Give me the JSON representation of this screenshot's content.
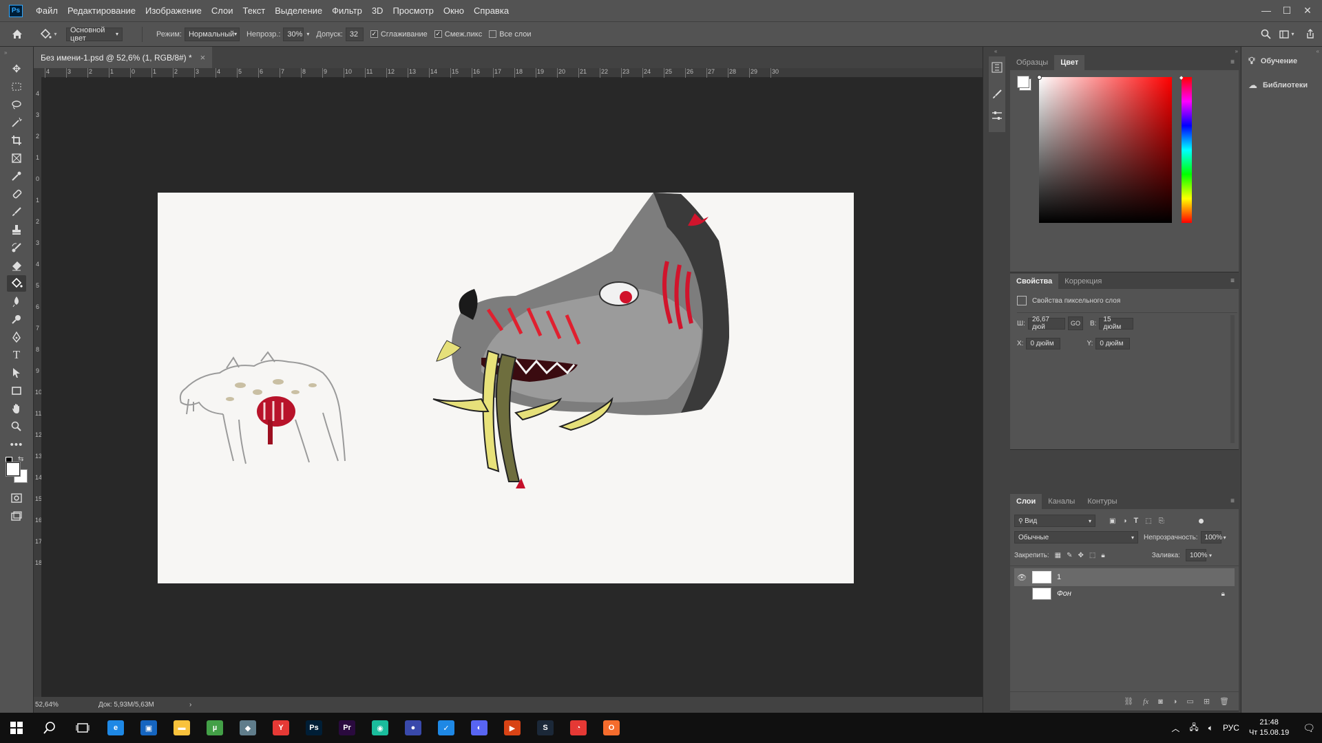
{
  "app": {
    "logo": "Ps"
  },
  "menu": [
    "Файл",
    "Редактирование",
    "Изображение",
    "Слои",
    "Текст",
    "Выделение",
    "Фильтр",
    "3D",
    "Просмотр",
    "Окно",
    "Справка"
  ],
  "window_controls": {
    "minimize": "—",
    "maximize": "☐",
    "close": "✕"
  },
  "options": {
    "fill_source": "Основной цвет",
    "mode_label": "Режим:",
    "mode_value": "Нормальный",
    "opacity_label": "Непрозр.:",
    "opacity_value": "30%",
    "tolerance_label": "Допуск:",
    "tolerance_value": "32",
    "antialias_label": "Сглаживание",
    "antialias_checked": true,
    "contiguous_label": "Смеж.пикс",
    "contiguous_checked": true,
    "all_layers_label": "Все слои",
    "all_layers_checked": false
  },
  "document": {
    "tab_title": "Без имени-1.psd @ 52,6% (1, RGB/8#) *",
    "tab_close": "×"
  },
  "rulers": {
    "h_ticks": [
      "4",
      "3",
      "2",
      "1",
      "0",
      "1",
      "2",
      "3",
      "4",
      "5",
      "6",
      "7",
      "8",
      "9",
      "10",
      "11",
      "12",
      "13",
      "14",
      "15",
      "16",
      "17",
      "18",
      "19",
      "20",
      "21",
      "22",
      "23",
      "24",
      "25",
      "26",
      "27",
      "28",
      "29",
      "30"
    ],
    "v_ticks": [
      "4",
      "3",
      "2",
      "1",
      "0",
      "1",
      "2",
      "3",
      "4",
      "5",
      "6",
      "7",
      "8",
      "9",
      "10",
      "11",
      "12",
      "13",
      "14",
      "15",
      "16",
      "17",
      "18"
    ]
  },
  "status": {
    "zoom": "52,64%",
    "doc": "Док: 5,93M/5,63M",
    "arrow": "›"
  },
  "panels": {
    "color_tabs": [
      "Образцы",
      "Цвет"
    ],
    "color_active": 1,
    "props_tabs": [
      "Свойства",
      "Коррекция"
    ],
    "props_active": 0,
    "props_subtitle": "Свойства пиксельного слоя",
    "w_label": "Ш:",
    "w_value": "26,67 дюй",
    "link_label": "GO",
    "h_label": "В:",
    "h_value": "15 дюйм",
    "x_label": "X:",
    "x_value": "0 дюйм",
    "y_label": "Y:",
    "y_value": "0 дюйм",
    "layers_tabs": [
      "Слои",
      "Каналы",
      "Контуры"
    ],
    "layers_active": 0,
    "filter_value": "Вид",
    "blend_value": "Обычные",
    "opacity_label": "Непрозрачность:",
    "opacity_value": "100%",
    "lock_label": "Закрепить:",
    "fill_label": "Заливка:",
    "fill_value": "100%",
    "layers": [
      {
        "name": "1",
        "visible": true,
        "selected": true,
        "locked": false
      },
      {
        "name": "Фон",
        "visible": false,
        "selected": false,
        "locked": true
      }
    ]
  },
  "learn": {
    "learn_label": "Обучение",
    "libraries_label": "Библиотеки"
  },
  "taskbar": {
    "apps": [
      {
        "icon": "edge-icon",
        "label": "e",
        "color": "#1e88e5"
      },
      {
        "icon": "store-icon",
        "label": "▣",
        "color": "#1565c0"
      },
      {
        "icon": "explorer-icon",
        "label": "▬",
        "color": "#f9c23c"
      },
      {
        "icon": "torrent-icon",
        "label": "µ",
        "color": "#43a047"
      },
      {
        "icon": "app-icon",
        "label": "◆",
        "color": "#607d8b"
      },
      {
        "icon": "yandex-icon",
        "label": "Y",
        "color": "#e53935"
      },
      {
        "icon": "photoshop-icon",
        "label": "Ps",
        "color": "#001e36"
      },
      {
        "icon": "premiere-icon",
        "label": "Pr",
        "color": "#2a0a3e"
      },
      {
        "icon": "game-icon",
        "label": "◉",
        "color": "#1abc9c"
      },
      {
        "icon": "app2-icon",
        "label": "●",
        "color": "#3949ab"
      },
      {
        "icon": "pocket-icon",
        "label": "✓",
        "color": "#1e88e5"
      },
      {
        "icon": "discord-icon",
        "label": "◐",
        "color": "#5865f2"
      },
      {
        "icon": "media-icon",
        "label": "▶",
        "color": "#d84315"
      },
      {
        "icon": "steam-icon",
        "label": "S",
        "color": "#1b2838"
      },
      {
        "icon": "app3-icon",
        "label": "◔",
        "color": "#e53935"
      },
      {
        "icon": "origin-icon",
        "label": "O",
        "color": "#f56c2d"
      }
    ],
    "lang": "РУС",
    "time": "21:48",
    "date": "Чт 15.08.19"
  },
  "colors": {
    "foreground": "#ffffff",
    "background": "#ffffff",
    "hue": "#ff0000"
  }
}
